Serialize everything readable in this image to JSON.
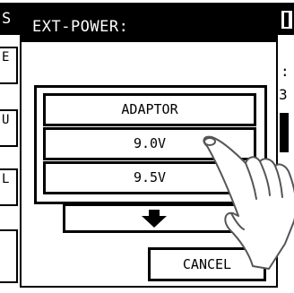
{
  "background_screen": {
    "title_char": "S",
    "side_buttons": [
      "E",
      "U",
      "L",
      ""
    ],
    "right_colon": ":",
    "right_char": "3"
  },
  "dialog": {
    "title": "EXT-POWER:",
    "options": [
      "ADAPTOR",
      "9.0V",
      "9.5V"
    ],
    "scroll_icon": "arrow-down-icon",
    "cancel_label": "CANCEL"
  },
  "overlay": {
    "hand_icon": "pointing-hand-icon"
  }
}
